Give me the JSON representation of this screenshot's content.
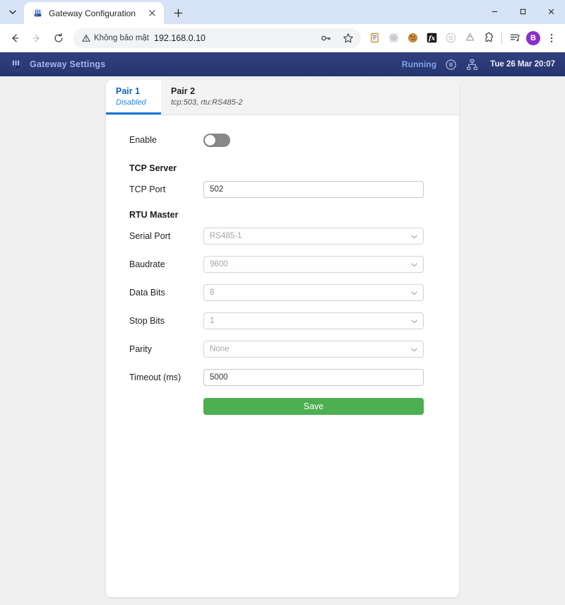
{
  "browser": {
    "tab": {
      "title": "Gateway Configuration",
      "favicon_icon": "gateway-favicon",
      "close_icon": "close-icon"
    },
    "tab_search_icon": "tab-search-chevron-icon",
    "new_tab_icon": "new-tab-plus-icon",
    "window_controls": {
      "minimize_icon": "minimize-icon",
      "maximize_icon": "maximize-icon",
      "close_icon": "window-close-icon"
    },
    "toolbar": {
      "back_icon": "back-arrow-icon",
      "forward_icon": "forward-arrow-icon",
      "reload_icon": "reload-icon",
      "security_label": "Không bảo mật",
      "security_icon": "warning-triangle-icon",
      "url": "192.168.0.10",
      "password_icon": "key-icon",
      "bookmark_icon": "star-icon",
      "extensions": [
        "clipboard-extension-icon",
        "react-devtools-icon",
        "cookie-editor-icon",
        "json-formatter-icon",
        "privacy-badger-icon",
        "recycle-extension-icon",
        "puzzle-extensions-icon"
      ],
      "reading_list_icon": "reading-list-icon",
      "avatar_initial": "B",
      "menu_icon": "three-dot-menu-icon"
    }
  },
  "app": {
    "logo_icon": "gateway-logo-icon",
    "title": "Gateway Settings",
    "status_label": "Running",
    "pause_icon": "pause-circle-icon",
    "network_icon": "network-hierarchy-icon",
    "datetime": "Tue 26 Mar 20:07"
  },
  "pair_tabs": [
    {
      "label": "Pair 1",
      "sub": "Disabled",
      "active": true
    },
    {
      "label": "Pair 2",
      "sub": "tcp:503, rtu:RS485-2",
      "active": false
    }
  ],
  "form": {
    "enable_label": "Enable",
    "enable_state": "off",
    "tcp_section": "TCP Server",
    "tcp_port_label": "TCP Port",
    "tcp_port_value": "502",
    "rtu_section": "RTU Master",
    "serial_port_label": "Serial Port",
    "serial_port_value": "RS485-1",
    "baudrate_label": "Baudrate",
    "baudrate_value": "9600",
    "data_bits_label": "Data Bits",
    "data_bits_value": "8",
    "stop_bits_label": "Stop Bits",
    "stop_bits_value": "1",
    "parity_label": "Parity",
    "parity_value": "None",
    "timeout_label": "Timeout (ms)",
    "timeout_value": "5000",
    "save_label": "Save",
    "dropdown_arrow_icon": "chevron-down-icon"
  },
  "colors": {
    "header_bg": "#2b3a78",
    "accent_blue": "#1565c0",
    "save_green": "#4caf50",
    "status_blue": "#7fa4ec"
  }
}
